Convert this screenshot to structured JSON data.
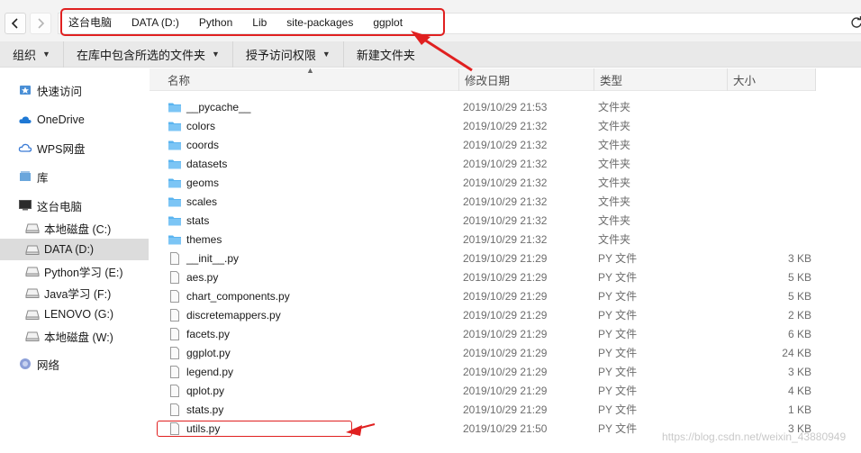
{
  "breadcrumbs": [
    "这台电脑",
    "DATA (D:)",
    "Python",
    "Lib",
    "site-packages",
    "ggplot"
  ],
  "toolbar": {
    "organize": "组织",
    "include_in_library": "在库中包含所选的文件夹",
    "grant_access": "授予访问权限",
    "new_folder": "新建文件夹"
  },
  "sidebar": [
    {
      "label": "快速访问",
      "icon": "star-icon"
    },
    {
      "label": "OneDrive",
      "icon": "cloud-icon"
    },
    {
      "label": "WPS网盘",
      "icon": "wps-cloud-icon"
    },
    {
      "label": "库",
      "icon": "library-icon"
    },
    {
      "label": "这台电脑",
      "icon": "computer-icon"
    },
    {
      "label": "本地磁盘 (C:)",
      "icon": "drive-icon"
    },
    {
      "label": "DATA (D:)",
      "icon": "drive-icon"
    },
    {
      "label": "Python学习 (E:)",
      "icon": "drive-icon"
    },
    {
      "label": "Java学习 (F:)",
      "icon": "drive-icon"
    },
    {
      "label": "LENOVO (G:)",
      "icon": "drive-icon"
    },
    {
      "label": "本地磁盘 (W:)",
      "icon": "drive-icon"
    },
    {
      "label": "网络",
      "icon": "network-icon"
    }
  ],
  "columns": {
    "name": "名称",
    "date": "修改日期",
    "type": "类型",
    "size": "大小"
  },
  "files": [
    {
      "name": "__pycache__",
      "date": "2019/10/29 21:53",
      "type": "文件夹",
      "size": "",
      "kind": "folder"
    },
    {
      "name": "colors",
      "date": "2019/10/29 21:32",
      "type": "文件夹",
      "size": "",
      "kind": "folder"
    },
    {
      "name": "coords",
      "date": "2019/10/29 21:32",
      "type": "文件夹",
      "size": "",
      "kind": "folder"
    },
    {
      "name": "datasets",
      "date": "2019/10/29 21:32",
      "type": "文件夹",
      "size": "",
      "kind": "folder"
    },
    {
      "name": "geoms",
      "date": "2019/10/29 21:32",
      "type": "文件夹",
      "size": "",
      "kind": "folder"
    },
    {
      "name": "scales",
      "date": "2019/10/29 21:32",
      "type": "文件夹",
      "size": "",
      "kind": "folder"
    },
    {
      "name": "stats",
      "date": "2019/10/29 21:32",
      "type": "文件夹",
      "size": "",
      "kind": "folder"
    },
    {
      "name": "themes",
      "date": "2019/10/29 21:32",
      "type": "文件夹",
      "size": "",
      "kind": "folder"
    },
    {
      "name": "__init__.py",
      "date": "2019/10/29 21:29",
      "type": "PY 文件",
      "size": "3 KB",
      "kind": "file"
    },
    {
      "name": "aes.py",
      "date": "2019/10/29 21:29",
      "type": "PY 文件",
      "size": "5 KB",
      "kind": "file"
    },
    {
      "name": "chart_components.py",
      "date": "2019/10/29 21:29",
      "type": "PY 文件",
      "size": "5 KB",
      "kind": "file"
    },
    {
      "name": "discretemappers.py",
      "date": "2019/10/29 21:29",
      "type": "PY 文件",
      "size": "2 KB",
      "kind": "file"
    },
    {
      "name": "facets.py",
      "date": "2019/10/29 21:29",
      "type": "PY 文件",
      "size": "6 KB",
      "kind": "file"
    },
    {
      "name": "ggplot.py",
      "date": "2019/10/29 21:29",
      "type": "PY 文件",
      "size": "24 KB",
      "kind": "file"
    },
    {
      "name": "legend.py",
      "date": "2019/10/29 21:29",
      "type": "PY 文件",
      "size": "3 KB",
      "kind": "file"
    },
    {
      "name": "qplot.py",
      "date": "2019/10/29 21:29",
      "type": "PY 文件",
      "size": "4 KB",
      "kind": "file"
    },
    {
      "name": "stats.py",
      "date": "2019/10/29 21:29",
      "type": "PY 文件",
      "size": "1 KB",
      "kind": "file"
    },
    {
      "name": "utils.py",
      "date": "2019/10/29 21:50",
      "type": "PY 文件",
      "size": "3 KB",
      "kind": "file"
    }
  ],
  "watermark": "https://blog.csdn.net/weixin_43880949",
  "colors": {
    "folder": "#5ab4f0",
    "annotation": "#e02020",
    "selected": "#dcdcdc"
  }
}
